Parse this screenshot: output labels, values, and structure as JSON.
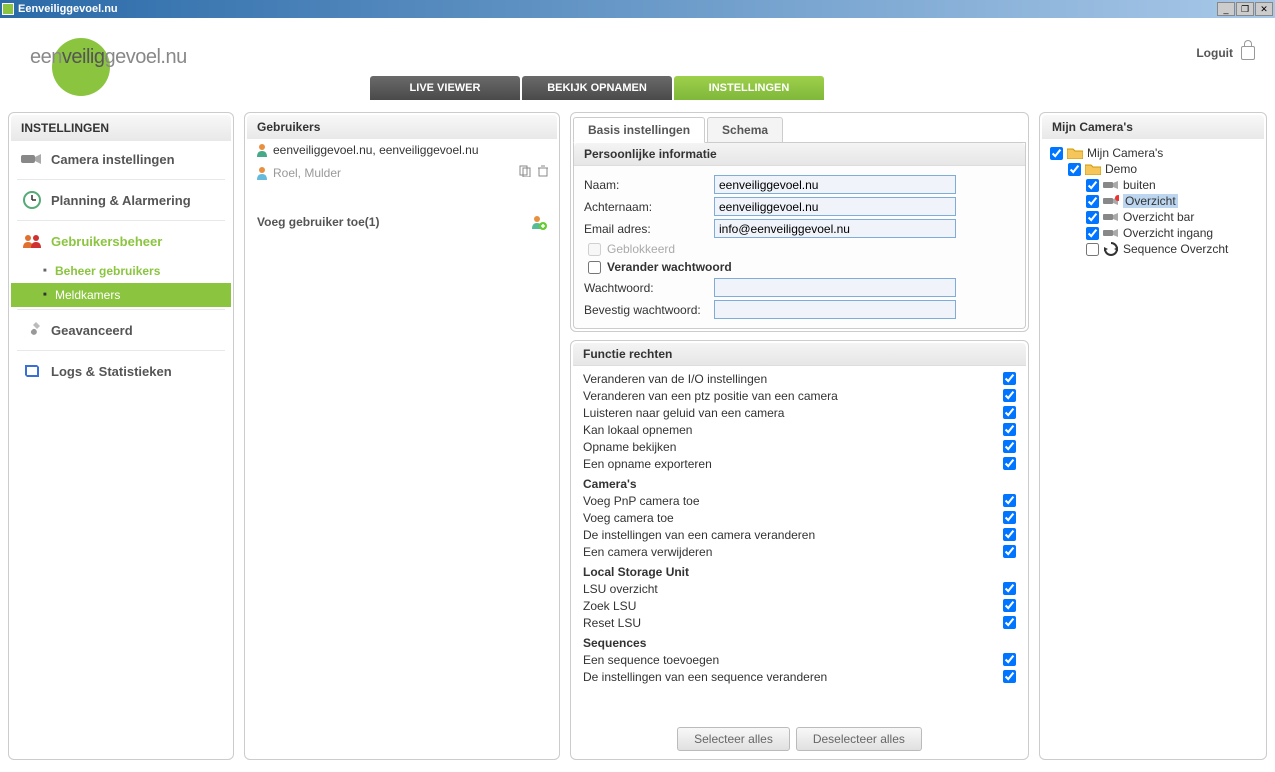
{
  "titlebar": {
    "text": "Eenveiliggevoel.nu"
  },
  "header": {
    "logo_pre": "een",
    "logo_mid": "veilig",
    "logo_post": "gevoel.nu",
    "tabs": [
      "LIVE VIEWER",
      "BEKIJK OPNAMEN",
      "INSTELLINGEN"
    ],
    "logout": "Loguit"
  },
  "sidebar": {
    "title": "INSTELLINGEN",
    "items": [
      {
        "label": "Camera instellingen",
        "icon": "camera"
      },
      {
        "label": "Planning & Alarmering",
        "icon": "clock"
      },
      {
        "label": "Gebruikersbeheer",
        "icon": "users",
        "active": true,
        "children": [
          {
            "label": "Beheer gebruikers",
            "state": "active"
          },
          {
            "label": "Meldkamers",
            "state": "hover"
          }
        ]
      },
      {
        "label": "Geavanceerd",
        "icon": "wrench"
      },
      {
        "label": "Logs & Statistieken",
        "icon": "book"
      }
    ]
  },
  "users": {
    "title": "Gebruikers",
    "list": [
      {
        "name": "eenveiliggevoel.nu, eenveiliggevoel.nu",
        "selected": false
      },
      {
        "name": "Roel, Mulder",
        "selected": true
      }
    ],
    "add_label": "Voeg gebruiker toe(1)"
  },
  "form": {
    "tabs": [
      "Basis instellingen",
      "Schema"
    ],
    "personal": {
      "title": "Persoonlijke informatie",
      "name_label": "Naam:",
      "name_value": "eenveiliggevoel.nu",
      "surname_label": "Achternaam:",
      "surname_value": "eenveiliggevoel.nu",
      "email_label": "Email adres:",
      "email_value": "info@eenveiliggevoel.nu",
      "blocked_label": "Geblokkeerd",
      "changepw_label": "Verander wachtwoord",
      "pw_label": "Wachtwoord:",
      "pwc_label": "Bevestig wachtwoord:"
    },
    "rights": {
      "title": "Functie rechten",
      "groups": [
        {
          "items": [
            "Veranderen van de I/O instellingen",
            "Veranderen van een ptz positie van een camera",
            "Luisteren naar geluid van een camera",
            "Kan lokaal opnemen",
            "Opname bekijken",
            "Een opname exporteren"
          ]
        },
        {
          "head": "Camera's",
          "items": [
            "Voeg PnP camera toe",
            "Voeg camera toe",
            "De instellingen van een camera veranderen",
            "Een camera verwijderen"
          ]
        },
        {
          "head": "Local Storage Unit",
          "items": [
            "LSU overzicht",
            "Zoek LSU",
            "Reset LSU"
          ]
        },
        {
          "head": "Sequences",
          "items": [
            "Een sequence toevoegen",
            "De instellingen van een sequence veranderen"
          ]
        }
      ],
      "select_all": "Selecteer alles",
      "deselect_all": "Deselecteer alles"
    }
  },
  "cameras": {
    "title": "Mijn Camera's",
    "root": "Mijn Camera's",
    "demo": "Demo",
    "children": [
      {
        "label": "buiten",
        "icon": "cam"
      },
      {
        "label": "Overzicht",
        "icon": "cam-rec",
        "selected": true
      },
      {
        "label": "Overzicht bar",
        "icon": "cam"
      },
      {
        "label": "Overzicht ingang",
        "icon": "cam"
      },
      {
        "label": "Sequence Overzcht",
        "icon": "seq",
        "checked": false
      }
    ]
  }
}
